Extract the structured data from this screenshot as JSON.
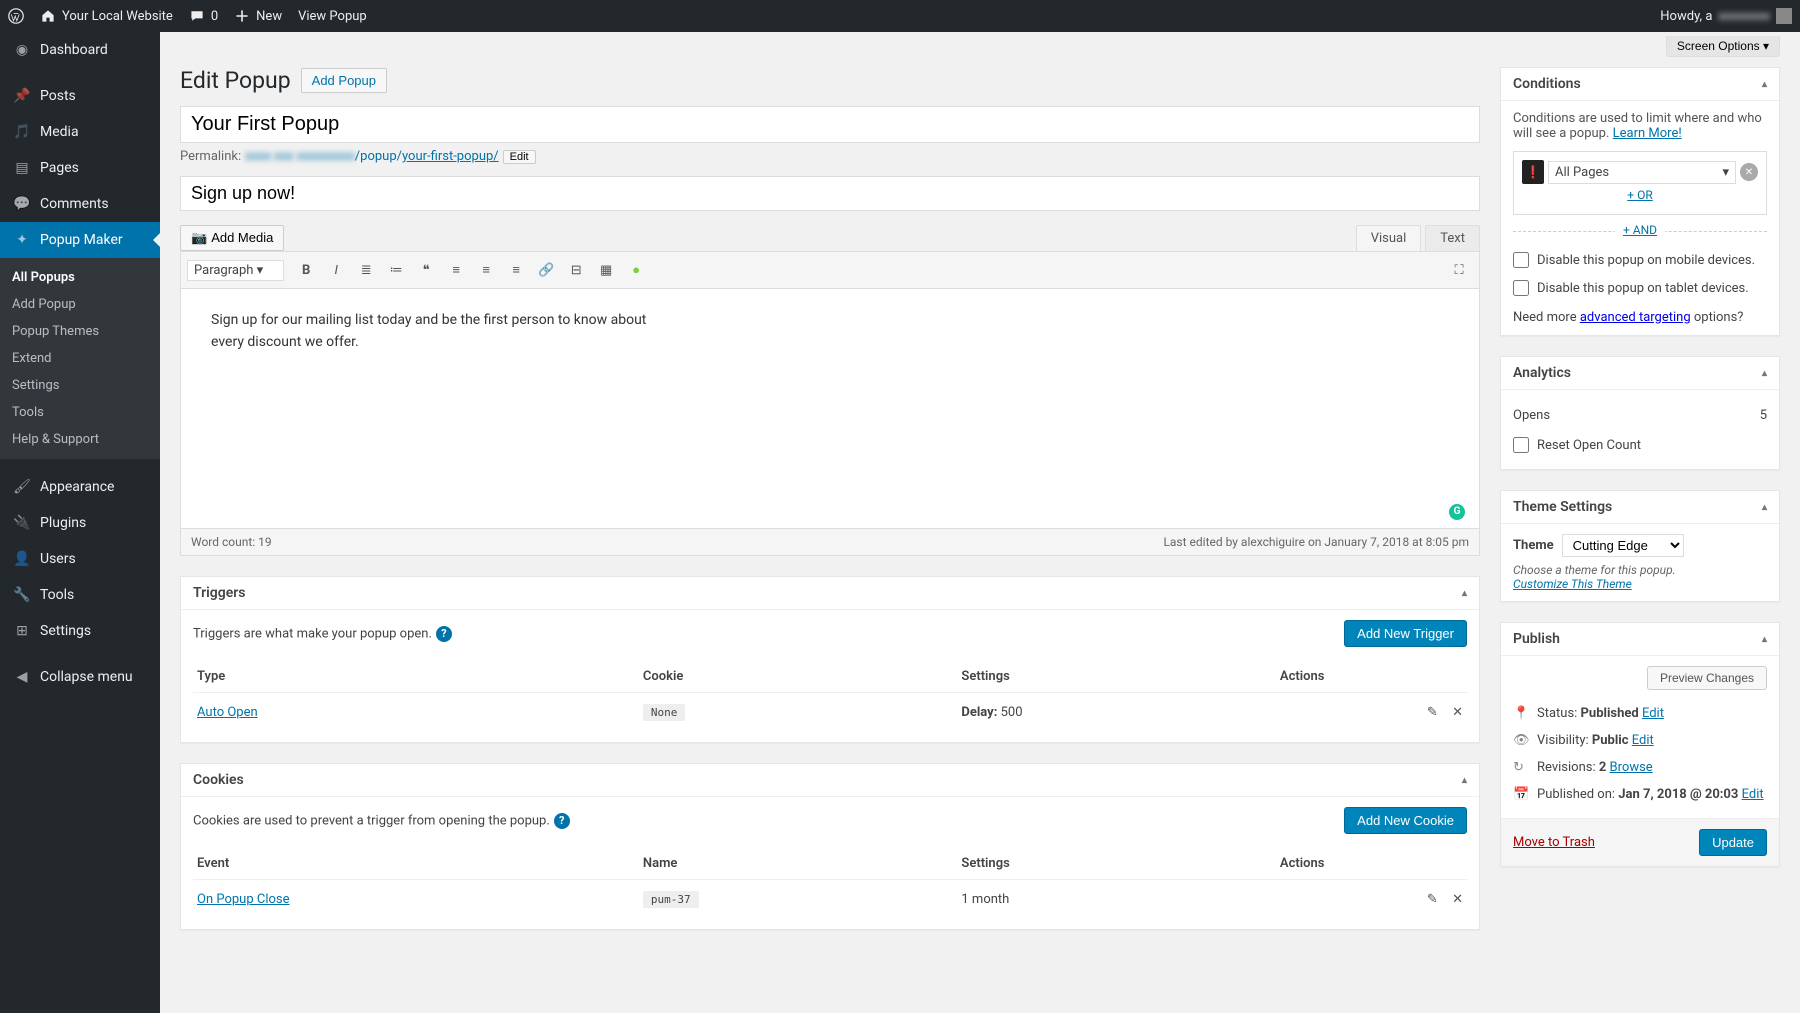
{
  "adminbar": {
    "site_name": "Your Local Website",
    "comments_count": "0",
    "new_label": "New",
    "view_label": "View Popup",
    "howdy": "Howdy, a",
    "howdy_blur": "xxxxxxxx"
  },
  "sidebar": {
    "dashboard": "Dashboard",
    "posts": "Posts",
    "media": "Media",
    "pages": "Pages",
    "comments": "Comments",
    "popup_maker": "Popup Maker",
    "submenu": {
      "all_popups": "All Popups",
      "add_popup": "Add Popup",
      "popup_themes": "Popup Themes",
      "extend": "Extend",
      "settings": "Settings",
      "tools": "Tools",
      "help_support": "Help & Support"
    },
    "appearance": "Appearance",
    "plugins": "Plugins",
    "users": "Users",
    "tools": "Tools",
    "settings": "Settings",
    "collapse": "Collapse menu"
  },
  "screen_options": "Screen Options",
  "page": {
    "heading": "Edit Popup",
    "add_popup_btn": "Add Popup",
    "title_value": "Your First Popup",
    "permalink_label": "Permalink:",
    "permalink_base_blur": "xxxx  xxx  xxxxxxxxx",
    "permalink_folder": "/popup/",
    "permalink_slug": "your-first-popup/",
    "edit_btn": "Edit",
    "subtitle_value": "Sign up now!"
  },
  "editor": {
    "add_media": "Add Media",
    "visual_tab": "Visual",
    "text_tab": "Text",
    "format": "Paragraph",
    "body": "Sign up for our mailing list today and be the first person to know about every discount we offer.",
    "word_count": "Word count: 19",
    "last_edited": "Last edited by alexchiguire on January 7, 2018 at 8:05 pm"
  },
  "triggers": {
    "title": "Triggers",
    "desc": "Triggers are what make your popup open.",
    "add_btn": "Add New Trigger",
    "cols": {
      "type": "Type",
      "cookie": "Cookie",
      "settings": "Settings",
      "actions": "Actions"
    },
    "row": {
      "type": "Auto Open",
      "cookie": "None",
      "settings_label": "Delay:",
      "settings_value": " 500"
    }
  },
  "cookies": {
    "title": "Cookies",
    "desc": "Cookies are used to prevent a trigger from opening the popup.",
    "add_btn": "Add New Cookie",
    "cols": {
      "event": "Event",
      "name": "Name",
      "settings": "Settings",
      "actions": "Actions"
    },
    "row": {
      "event": "On Popup Close",
      "name": "pum-37",
      "settings": "1 month"
    }
  },
  "conditions": {
    "title": "Conditions",
    "desc_1": "Conditions are used to limit where and who will see a popup. ",
    "learn_more": "Learn More!",
    "all_pages": "All Pages",
    "or": "+ OR",
    "and": "+ AND",
    "disable_mobile": "Disable this popup on mobile devices.",
    "disable_tablet": "Disable this popup on tablet devices.",
    "need_more_1": "Need more ",
    "need_more_link": "advanced targeting",
    "need_more_2": " options?"
  },
  "analytics": {
    "title": "Analytics",
    "opens_label": "Opens",
    "opens_value": "5",
    "reset": "Reset Open Count"
  },
  "theme": {
    "title": "Theme Settings",
    "label": "Theme",
    "value": "Cutting Edge",
    "hint": "Choose a theme for this popup.",
    "customize": "Customize This Theme"
  },
  "publish": {
    "title": "Publish",
    "preview": "Preview Changes",
    "status_label": "Status: ",
    "status_value": "Published",
    "visibility_label": "Visibility: ",
    "visibility_value": "Public",
    "revisions_label": "Revisions: ",
    "revisions_count": "2",
    "browse": "Browse",
    "published_label": "Published on: ",
    "published_value": "Jan 7, 2018 @ 20:03",
    "edit": "Edit",
    "trash": "Move to Trash",
    "update_btn": "Update"
  }
}
